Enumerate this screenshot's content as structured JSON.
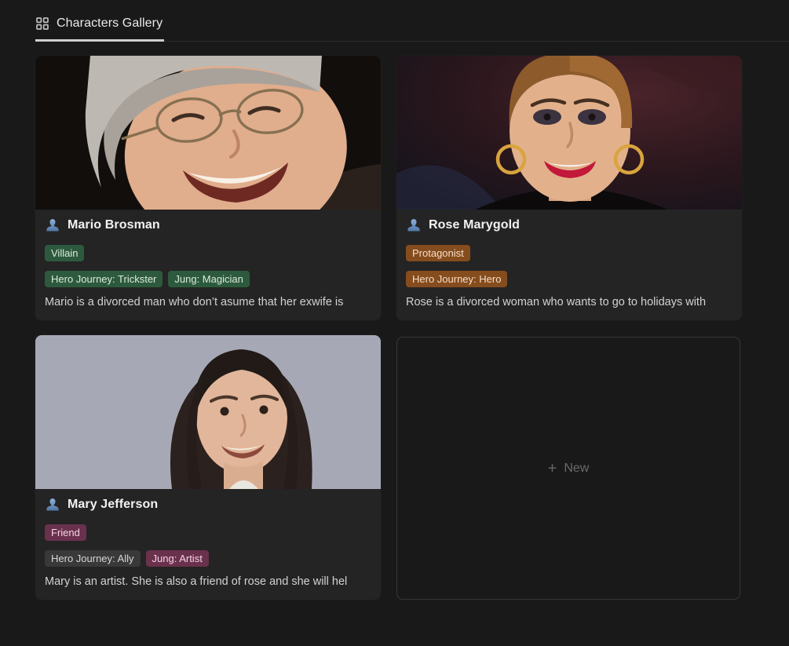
{
  "colors": {
    "page_bg": "#191919",
    "card_bg": "#242424",
    "header_divider": "#2b2b2b",
    "tab_underline": "#cfcfcf",
    "tag_green_bg": "#2D5A3E",
    "tag_green_text": "#DCEADC",
    "tag_orange_bg": "#854C1D",
    "tag_orange_text": "#F8DEC7",
    "tag_pink_bg": "#6A314D",
    "tag_pink_text": "#F4D4E3",
    "tag_gray_bg": "#393939",
    "tag_gray_text": "#D6D6D6",
    "person_icon_blue": "#6F9CCB"
  },
  "header": {
    "tab_label": "Characters Gallery",
    "view_icon": "gallery-grid-icon"
  },
  "cards": [
    {
      "name": "Mario Brosman",
      "icon": "person-icon",
      "cover": "mario-portrait",
      "tags_row1": [
        {
          "label": "Villain",
          "color": "green"
        }
      ],
      "tags_row2": [
        {
          "label": "Hero Journey: Trickster",
          "color": "green"
        },
        {
          "label": "Jung: Magician",
          "color": "green"
        }
      ],
      "description": "Mario is a divorced man who don’t asume that her exwife is"
    },
    {
      "name": "Rose Marygold",
      "icon": "person-icon",
      "cover": "rose-portrait",
      "tags_row1": [
        {
          "label": "Protagonist",
          "color": "orange"
        }
      ],
      "tags_row2": [
        {
          "label": "Hero Journey: Hero",
          "color": "orange"
        }
      ],
      "description": "Rose is a divorced woman who wants to go to holidays with"
    },
    {
      "name": "Mary Jefferson",
      "icon": "person-icon",
      "cover": "mary-portrait",
      "tags_row1": [
        {
          "label": "Friend",
          "color": "pink"
        }
      ],
      "tags_row2": [
        {
          "label": "Hero Journey: Ally",
          "color": "gray"
        },
        {
          "label": "Jung: Artist",
          "color": "pink"
        }
      ],
      "description": "Mary is an artist. She is also a friend of rose and she will hel"
    }
  ],
  "new_card": {
    "plus_glyph": "+",
    "label": "New"
  }
}
